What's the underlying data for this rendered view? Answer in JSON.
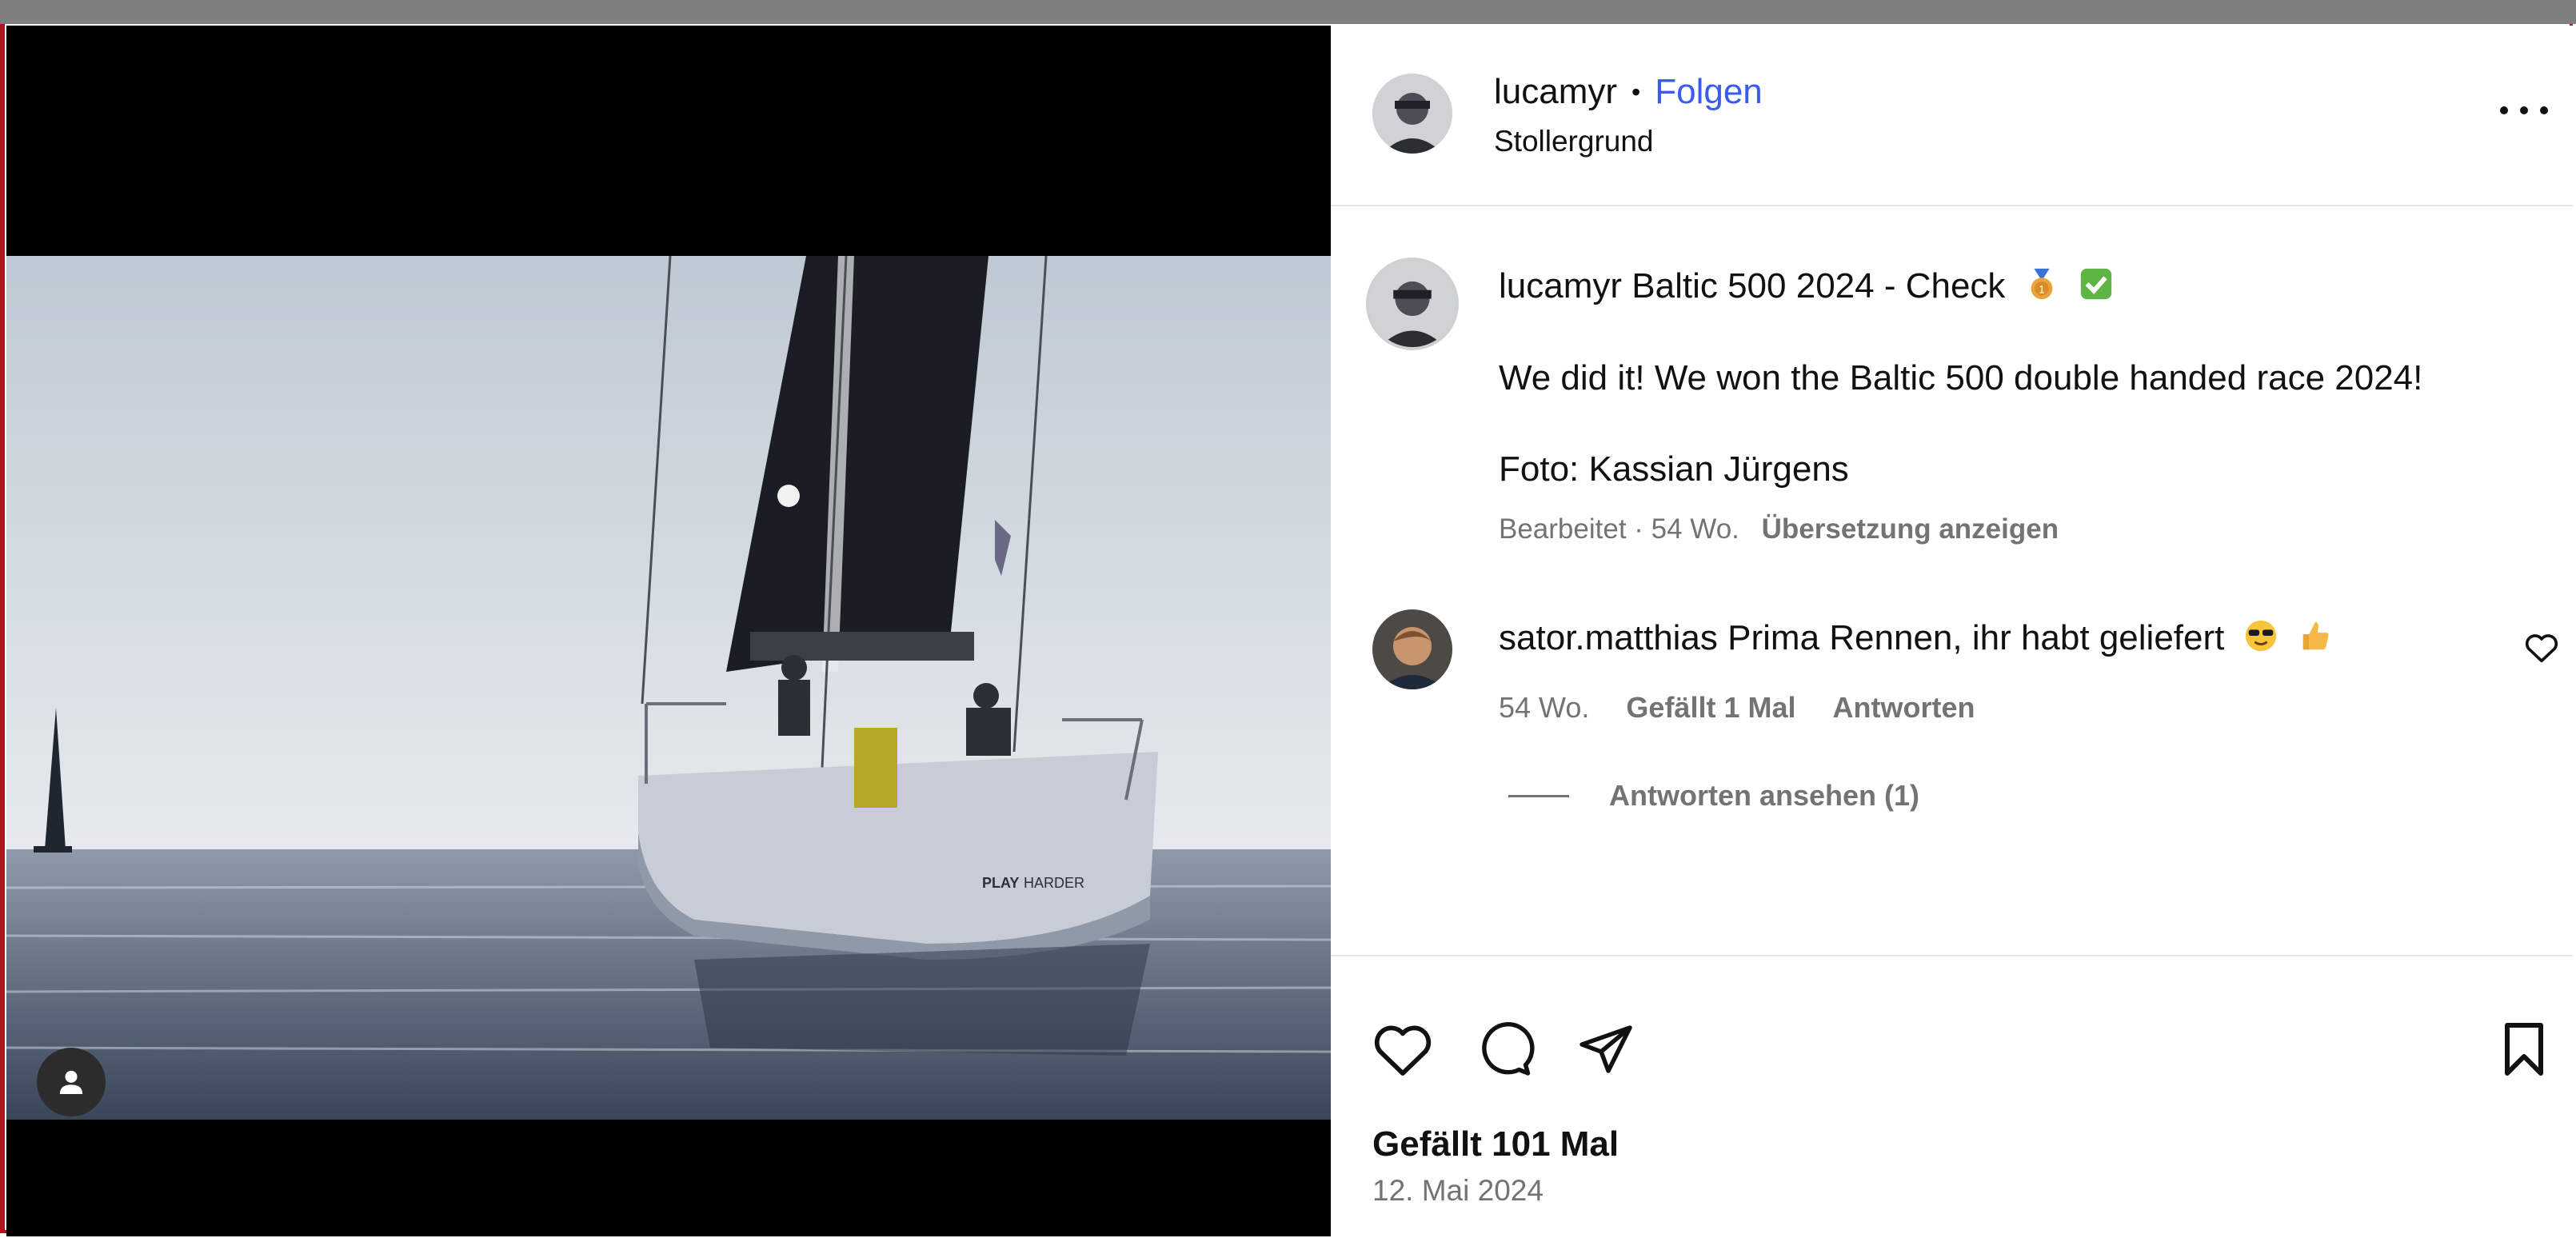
{
  "post": {
    "username": "lucamyr",
    "separator": "•",
    "follow_label": "Folgen",
    "location": "Stollergrund",
    "more_label": "..."
  },
  "caption": {
    "username": "lucamyr",
    "title_text": "Baltic 500 2024 - Check",
    "line2": "We did it! We won the Baltic 500 double handed race 2024!",
    "line3": "Foto: Kassian Jürgens",
    "meta": "Bearbeitet · 54 Wo.",
    "translate_label": "Übersetzung anzeigen"
  },
  "comment": {
    "username": "sator.matthias",
    "text": "Prima Rennen, ihr habt geliefert",
    "age": "54 Wo.",
    "likes_label": "Gefällt 1 Mal",
    "reply_label": "Antworten",
    "view_replies_label": "Antworten ansehen (1)"
  },
  "photo": {
    "boat_text_play": "PLAY",
    "boat_text_harder": "HARDER"
  },
  "footer": {
    "likes": "Gefällt 101 Mal",
    "date": "12. Mai 2024"
  },
  "colors": {
    "follow": "#3b5bf0",
    "muted": "#737373",
    "frame": "#b1121b"
  },
  "icons": [
    "user-tag-icon",
    "more-icon",
    "heart-icon",
    "comment-icon",
    "share-icon",
    "bookmark-icon",
    "medal-emoji",
    "check-emoji",
    "sunglasses-emoji",
    "thumbs-up-emoji"
  ]
}
